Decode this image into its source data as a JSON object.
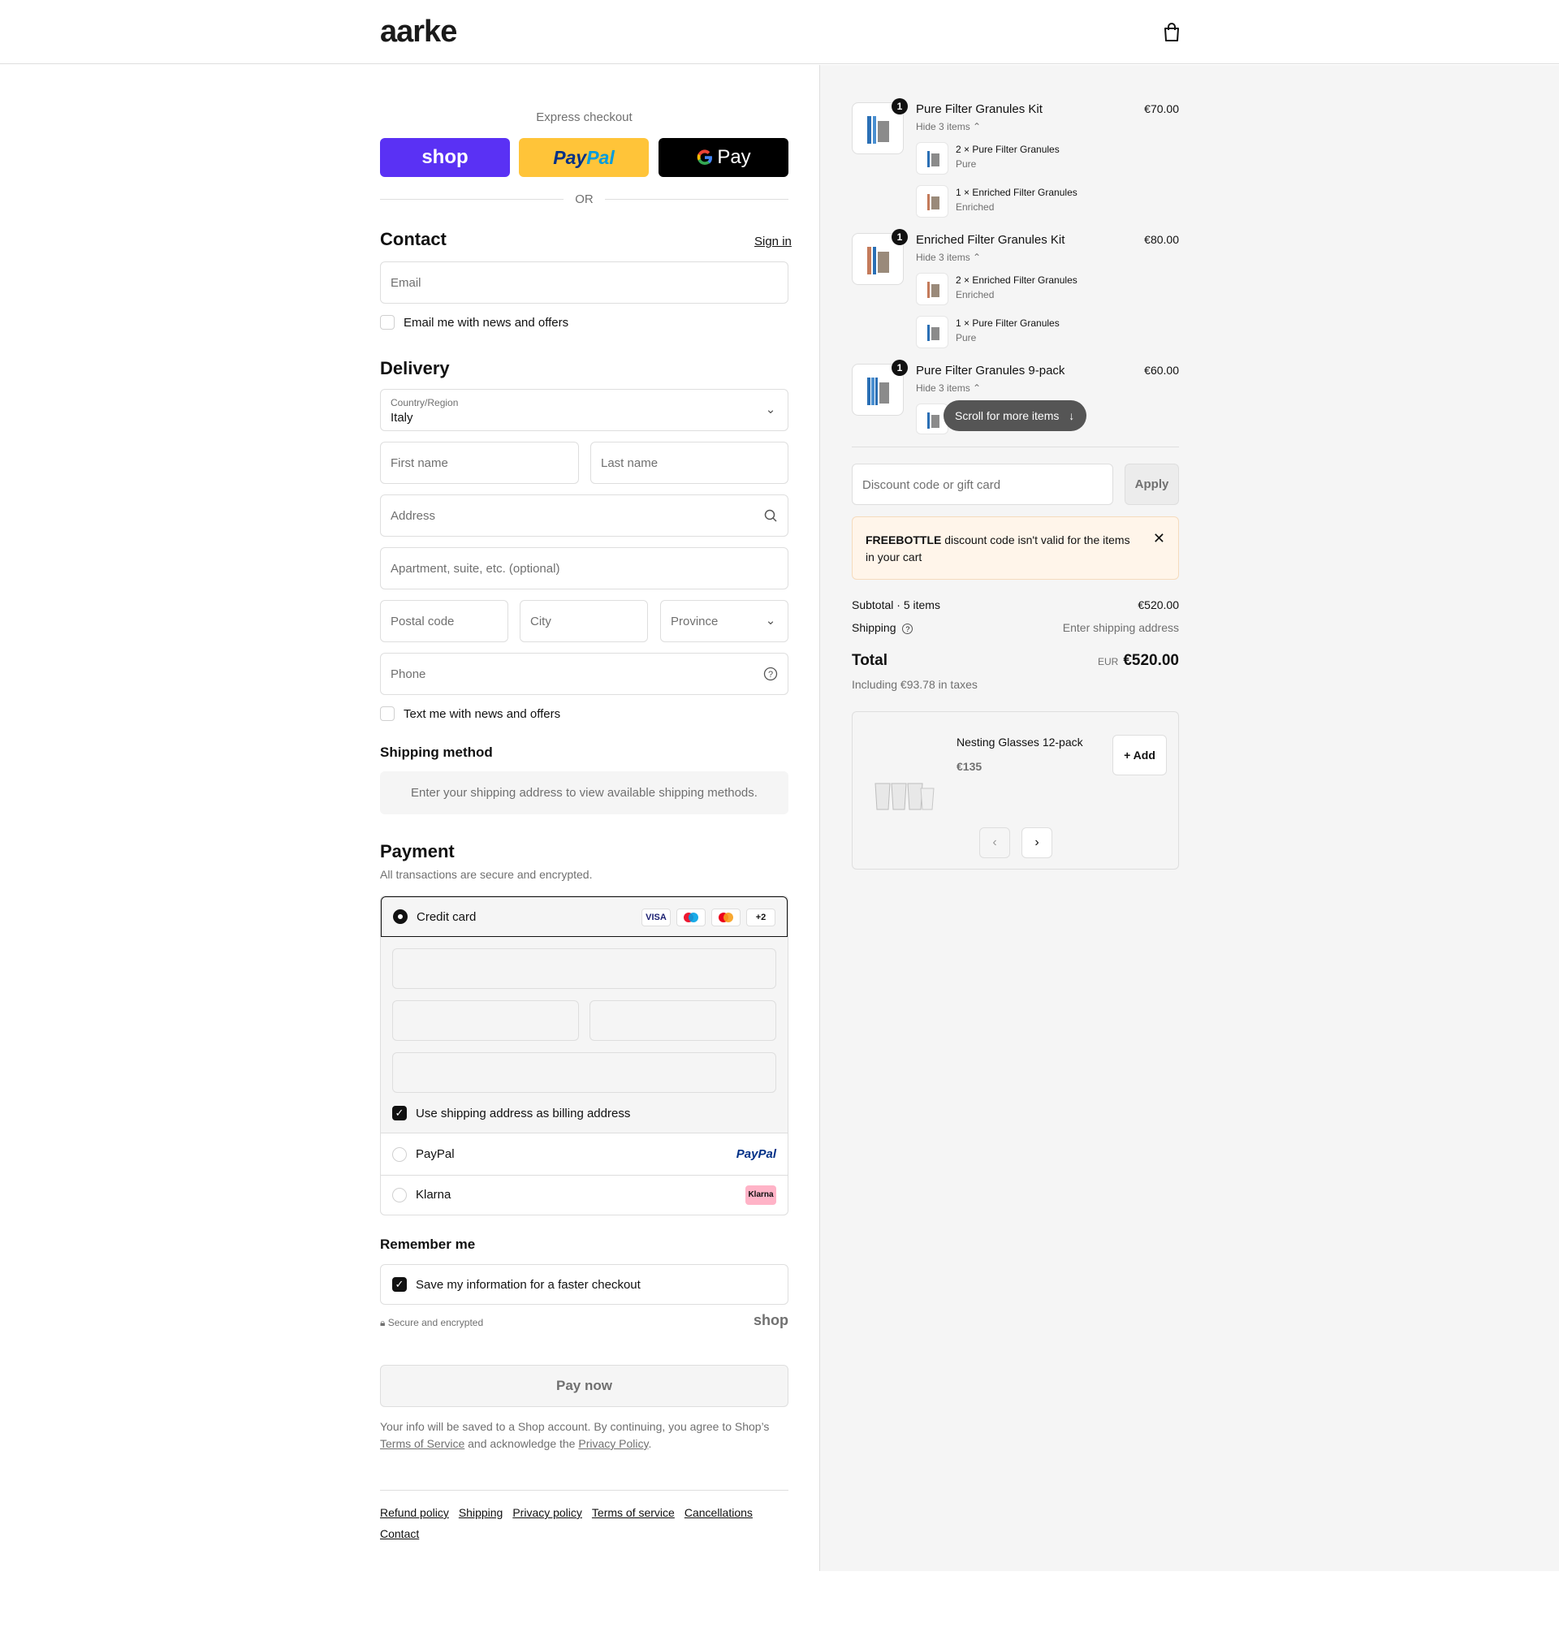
{
  "brand": {
    "logo": "aarke"
  },
  "express": {
    "label": "Express checkout",
    "shop": "shop",
    "paypal_a": "Pay",
    "paypal_b": "Pal",
    "gpay": "Pay",
    "or": "OR"
  },
  "contact": {
    "title": "Contact",
    "sign_in": "Sign in",
    "email_placeholder": "Email",
    "news_label": "Email me with news and offers"
  },
  "delivery": {
    "title": "Delivery",
    "country_label": "Country/Region",
    "country_value": "Italy",
    "first_name": "First name",
    "last_name": "Last name",
    "address": "Address",
    "apartment": "Apartment, suite, etc. (optional)",
    "postal": "Postal code",
    "city": "City",
    "province": "Province",
    "phone": "Phone",
    "text_label": "Text me with news and offers"
  },
  "shipping_method": {
    "title": "Shipping method",
    "note": "Enter your shipping address to view available shipping methods."
  },
  "payment": {
    "title": "Payment",
    "subtitle": "All transactions are secure and encrypted.",
    "credit_card": "Credit card",
    "card_logos": [
      "VISA",
      "",
      "",
      "+2"
    ],
    "billing_label": "Use shipping address as billing address",
    "paypal": "PayPal",
    "paypal_logo": "PayPal",
    "klarna": "Klarna",
    "klarna_logo": "Klarna"
  },
  "remember": {
    "title": "Remember me",
    "save_label": "Save my information for a faster checkout",
    "secure": "Secure and encrypted",
    "shop_mark": "shop"
  },
  "pay_now": "Pay now",
  "legal": {
    "line1": "Your info will be saved to a Shop account. By continuing, you agree to Shop’s",
    "tos": "Terms of Service",
    "mid": "and acknowledge the",
    "privacy": "Privacy Policy",
    "end": "."
  },
  "footer": [
    "Refund policy",
    "Shipping",
    "Privacy policy",
    "Terms of service",
    "Cancellations",
    "Contact"
  ],
  "cart": {
    "items": [
      {
        "qty": "1",
        "name": "Pure Filter Granules Kit",
        "price": "€70.00",
        "hide": "Hide 3 items",
        "subs": [
          {
            "name": "2 × Pure Filter Granules",
            "variant": "Pure"
          },
          {
            "name": "1 × Enriched Filter Granules",
            "variant": "Enriched"
          }
        ]
      },
      {
        "qty": "1",
        "name": "Enriched Filter Granules Kit",
        "price": "€80.00",
        "hide": "Hide 3 items",
        "subs": [
          {
            "name": "2 × Enriched Filter Granules",
            "variant": "Enriched"
          },
          {
            "name": "1 × Pure Filter Granules",
            "variant": "Pure"
          }
        ]
      },
      {
        "qty": "1",
        "name": "Pure Filter Granules 9-pack",
        "price": "€60.00",
        "hide": "Hide 3 items",
        "subs": []
      }
    ],
    "scroll_pill": "Scroll for more items",
    "discount_placeholder": "Discount code or gift card",
    "apply": "Apply",
    "alert_code": "FREEBOTTLE",
    "alert_msg": " discount code isn't valid for the items in your cart",
    "subtotal_label": "Subtotal · 5 items",
    "subtotal_value": "€520.00",
    "shipping_label": "Shipping",
    "shipping_value": "Enter shipping address",
    "total_label": "Total",
    "total_currency": "EUR",
    "total_value": "€520.00",
    "taxes": "Including €93.78 in taxes",
    "rec_name": "Nesting Glasses 12-pack",
    "rec_price": "€135",
    "rec_add": "+ Add"
  }
}
